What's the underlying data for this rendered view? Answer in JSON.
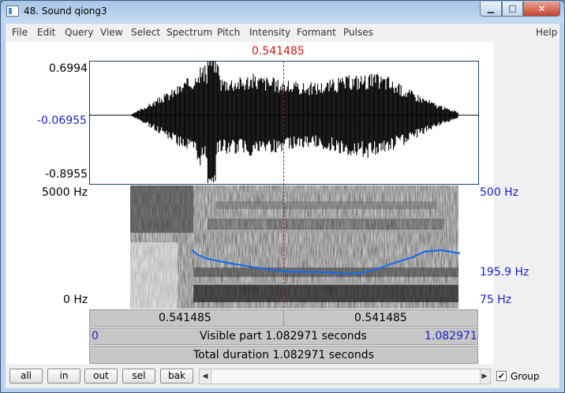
{
  "window": {
    "title": "48. Sound qiong3",
    "minimize": "▁",
    "maximize": "□",
    "close": "✕"
  },
  "menu": [
    "File",
    "Edit",
    "Query",
    "View",
    "Select",
    "Spectrum",
    "Pitch",
    "Intensity",
    "Formant",
    "Pulses"
  ],
  "help": "Help",
  "cursor": {
    "time": "0.541485"
  },
  "waveform": {
    "max": "0.6994",
    "zero": "-0.06955",
    "min": "-0.8955"
  },
  "spectrogram": {
    "freq_max": "5000 Hz",
    "freq_min": "0 Hz"
  },
  "pitch_axis": {
    "max": "500 Hz",
    "current": "195.9 Hz",
    "min": "75 Hz"
  },
  "bars": {
    "left_time": "0.541485",
    "right_time": "0.541485",
    "visible_start": "0",
    "visible_label": "Visible part 1.082971 seconds",
    "visible_end": "1.082971",
    "total_label": "Total duration 1.082971 seconds"
  },
  "zoom_buttons": [
    "all",
    "in",
    "out",
    "sel",
    "bak"
  ],
  "group": {
    "label": "Group",
    "checked": true
  },
  "colors": {
    "cursor": "#d01515",
    "pitch": "#1a6ee8",
    "axis_label": "#1d1dc8"
  },
  "icons": {
    "app": "praat-window-icon",
    "scroll_left": "triangle-left",
    "scroll_right": "triangle-right",
    "check": "checkmark"
  }
}
